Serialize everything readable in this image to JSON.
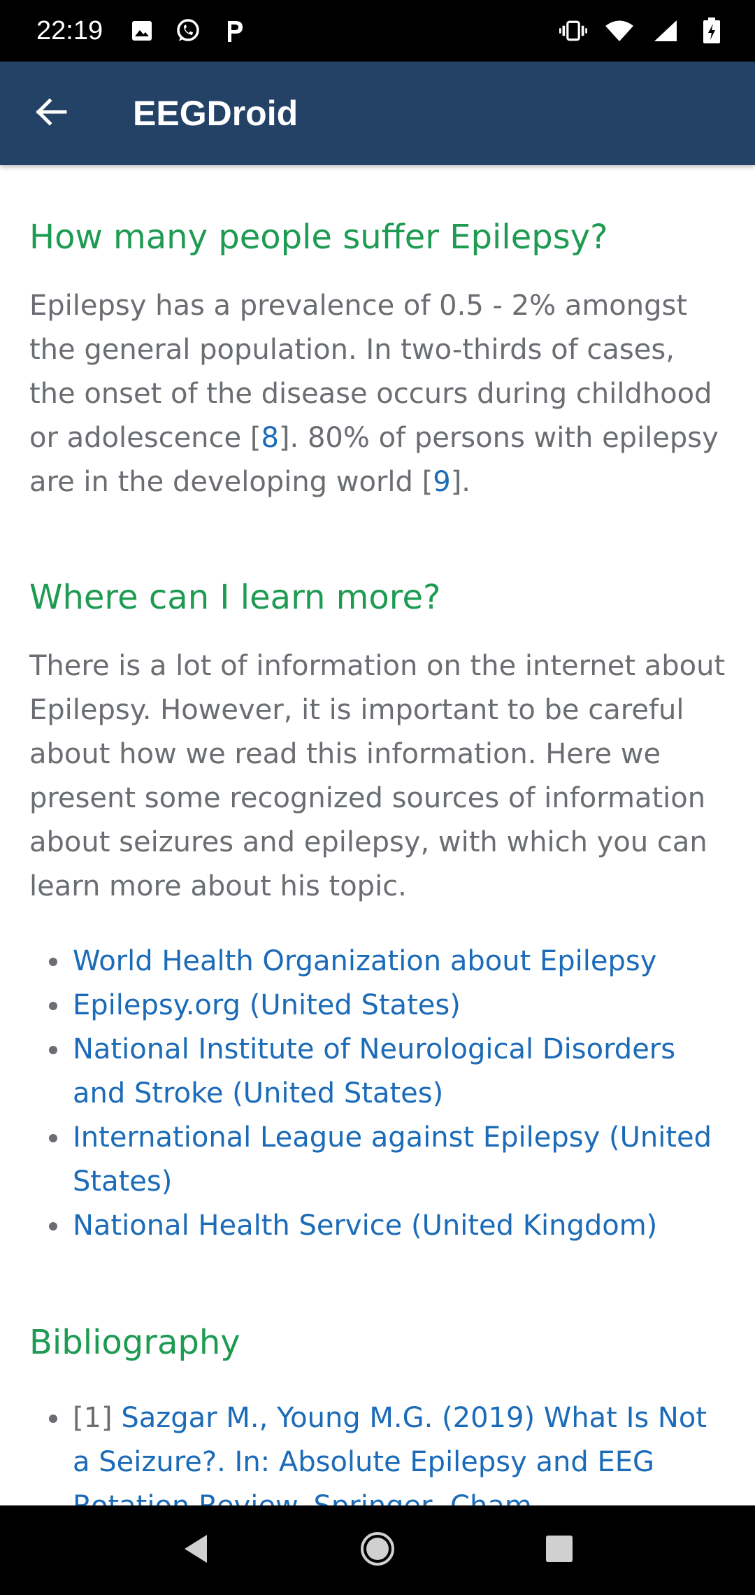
{
  "status_bar": {
    "time": "22:19",
    "left_icons": [
      "image-icon",
      "whatsapp-icon",
      "p-icon"
    ],
    "right_icons": [
      "vibrate-icon",
      "wifi-icon",
      "signal-icon",
      "battery-charging-icon"
    ]
  },
  "app_bar": {
    "title": "EEGDroid",
    "back_icon": "arrow-back-icon",
    "background": "#234266"
  },
  "sections": {
    "prevalence": {
      "title": "How many people suffer Epilepsy?",
      "text_1": "Epilepsy has a prevalence of 0.5 - 2% amongst the general population. In two-thirds of cases, the onset of the disease occurs during childhood or adolescence [",
      "ref_1": "8",
      "text_2": "]. 80% of persons with epilepsy are in the developing world [",
      "ref_2": "9",
      "text_3": "]."
    },
    "learn_more": {
      "title": "Where can I learn more?",
      "text": "There is a lot of information on the internet about Epilepsy. However, it is important to be careful about how we read this information. Here we present some recognized sources of information about seizures and epilepsy, with which you can learn more about his topic.",
      "links": [
        "World Health Organization about Epilepsy",
        "Epilepsy.org (United States)",
        "National Institute of Neurological Disorders and Stroke (United States)",
        "International League against Epilepsy (United States)",
        "National Health Service (United Kingdom)"
      ]
    },
    "bibliography": {
      "title": "Bibliography",
      "items": [
        {
          "number": "[1] ",
          "text": "Sazgar M., Young M.G. (2019) What Is Not a Seizure?. In: Absolute Epilepsy and EEG Rotation Review. Springer, Cham"
        }
      ]
    }
  },
  "colors": {
    "heading": "#1e9b52",
    "body_text": "#6a6d72",
    "link": "#1b6bb8"
  },
  "nav_bar": {
    "buttons": [
      "back-triangle-icon",
      "home-circle-icon",
      "recents-square-icon"
    ]
  }
}
